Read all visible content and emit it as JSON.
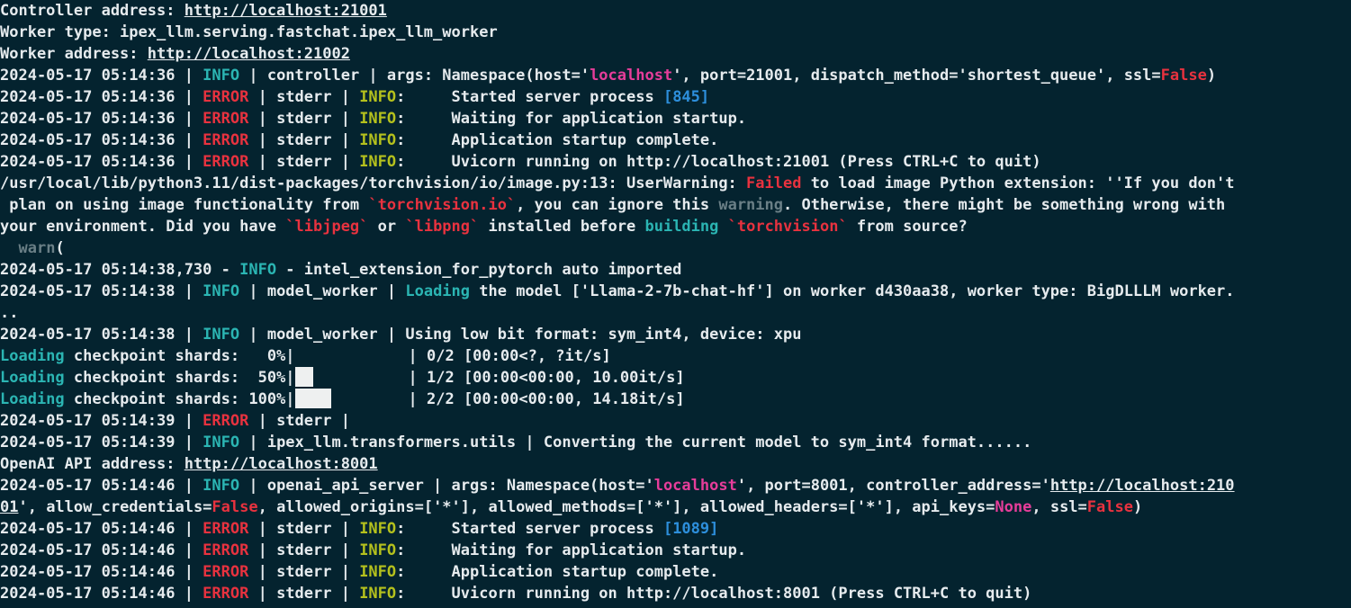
{
  "terminal": {
    "background": "#04232f",
    "lines": [
      [
        {
          "t": "Controller address: ",
          "c": "plain"
        },
        {
          "t": "http://localhost:21001",
          "c": "url"
        }
      ],
      [
        {
          "t": "Worker type: ipex_llm.serving.fastchat.ipex_llm_worker",
          "c": "plain"
        }
      ],
      [
        {
          "t": "Worker address: ",
          "c": "plain"
        },
        {
          "t": "http://localhost:21002",
          "c": "url"
        }
      ],
      [
        {
          "t": "2024-05-17 05:14:36 | ",
          "c": "plain"
        },
        {
          "t": "INFO",
          "c": "info"
        },
        {
          "t": " | controller | args: Namespace(host='",
          "c": "plain"
        },
        {
          "t": "localhost",
          "c": "str"
        },
        {
          "t": "', port=21001, dispatch_method='shortest_queue', ssl=",
          "c": "plain"
        },
        {
          "t": "False",
          "c": "false"
        },
        {
          "t": ")",
          "c": "plain"
        }
      ],
      [
        {
          "t": "2024-05-17 05:14:36 | ",
          "c": "plain"
        },
        {
          "t": "ERROR",
          "c": "error"
        },
        {
          "t": " | stderr | ",
          "c": "plain"
        },
        {
          "t": "INFO",
          "c": "info-y"
        },
        {
          "t": ":     Started server process ",
          "c": "plain"
        },
        {
          "t": "[845]",
          "c": "num"
        }
      ],
      [
        {
          "t": "2024-05-17 05:14:36 | ",
          "c": "plain"
        },
        {
          "t": "ERROR",
          "c": "error"
        },
        {
          "t": " | stderr | ",
          "c": "plain"
        },
        {
          "t": "INFO",
          "c": "info-y"
        },
        {
          "t": ":     Waiting for application startup.",
          "c": "plain"
        }
      ],
      [
        {
          "t": "2024-05-17 05:14:36 | ",
          "c": "plain"
        },
        {
          "t": "ERROR",
          "c": "error"
        },
        {
          "t": " | stderr | ",
          "c": "plain"
        },
        {
          "t": "INFO",
          "c": "info-y"
        },
        {
          "t": ":     Application startup complete.",
          "c": "plain"
        }
      ],
      [
        {
          "t": "2024-05-17 05:14:36 | ",
          "c": "plain"
        },
        {
          "t": "ERROR",
          "c": "error"
        },
        {
          "t": " | stderr | ",
          "c": "plain"
        },
        {
          "t": "INFO",
          "c": "info-y"
        },
        {
          "t": ":     Uvicorn running on http://localhost:21001 (Press CTRL+C to quit)",
          "c": "plain"
        }
      ],
      [
        {
          "t": "/usr/local/lib/python3.11/dist-packages/torchvision/io/image.py:13: UserWarning: ",
          "c": "plain"
        },
        {
          "t": "Failed",
          "c": "red"
        },
        {
          "t": " to load image Python extension: ''If you don't",
          "c": "plain"
        }
      ],
      [
        {
          "t": " plan on using image functionality from ",
          "c": "plain"
        },
        {
          "t": "`torchvision.io`",
          "c": "red"
        },
        {
          "t": ", you can ignore this ",
          "c": "plain"
        },
        {
          "t": "warning",
          "c": "gray"
        },
        {
          "t": ". Otherwise, there might be something wrong with",
          "c": "plain"
        }
      ],
      [
        {
          "t": "your environment. Did you have ",
          "c": "plain"
        },
        {
          "t": "`libjpeg`",
          "c": "red"
        },
        {
          "t": " or ",
          "c": "plain"
        },
        {
          "t": "`libpng`",
          "c": "red"
        },
        {
          "t": " installed before ",
          "c": "plain"
        },
        {
          "t": "building",
          "c": "info"
        },
        {
          "t": " ",
          "c": "plain"
        },
        {
          "t": "`torchvision`",
          "c": "red"
        },
        {
          "t": " from source?",
          "c": "plain"
        }
      ],
      [
        {
          "t": "  ",
          "c": "plain"
        },
        {
          "t": "warn",
          "c": "gray"
        },
        {
          "t": "(",
          "c": "plain"
        }
      ],
      [
        {
          "t": "2024-05-17 05:14:38,730 - ",
          "c": "plain"
        },
        {
          "t": "INFO",
          "c": "info"
        },
        {
          "t": " - intel_extension_for_pytorch auto imported",
          "c": "plain"
        }
      ],
      [
        {
          "t": "2024-05-17 05:14:38 | ",
          "c": "plain"
        },
        {
          "t": "INFO",
          "c": "info"
        },
        {
          "t": " | model_worker | ",
          "c": "plain"
        },
        {
          "t": "Loading",
          "c": "info"
        },
        {
          "t": " the model ['Llama-2-7b-chat-hf'] on worker d430aa38, worker type: BigDLLLM worker.",
          "c": "plain"
        }
      ],
      [
        {
          "t": "..",
          "c": "plain"
        }
      ],
      [
        {
          "t": "2024-05-17 05:14:38 | ",
          "c": "plain"
        },
        {
          "t": "INFO",
          "c": "info"
        },
        {
          "t": " | model_worker | Using low bit format: sym_int4, device: xpu",
          "c": "plain"
        }
      ],
      [
        {
          "t": "Loading",
          "c": "info"
        },
        {
          "t": " checkpoint shards:   0%|",
          "c": "plain"
        },
        {
          "bar": 0
        },
        {
          "t": "| 0/2 [00:00<?, ?it/s]",
          "c": "plain"
        }
      ],
      [
        {
          "t": "Loading",
          "c": "info"
        },
        {
          "t": " checkpoint shards:  50%|",
          "c": "plain"
        },
        {
          "bar": 0.5
        },
        {
          "t": "| 1/2 [00:00<00:00, 10.00it/s]",
          "c": "plain"
        }
      ],
      [
        {
          "t": "Loading",
          "c": "info"
        },
        {
          "t": " checkpoint shards: 100%|",
          "c": "plain"
        },
        {
          "bar": 1
        },
        {
          "t": "| 2/2 [00:00<00:00, 14.18it/s]",
          "c": "plain"
        }
      ],
      [
        {
          "t": "2024-05-17 05:14:39 | ",
          "c": "plain"
        },
        {
          "t": "ERROR",
          "c": "error"
        },
        {
          "t": " | stderr |",
          "c": "plain"
        }
      ],
      [
        {
          "t": "2024-05-17 05:14:39 | ",
          "c": "plain"
        },
        {
          "t": "INFO",
          "c": "info"
        },
        {
          "t": " | ipex_llm.transformers.utils | Converting the current model to sym_int4 format......",
          "c": "plain"
        }
      ],
      [
        {
          "t": "OpenAI API address: ",
          "c": "plain"
        },
        {
          "t": "http://localhost:8001",
          "c": "url"
        }
      ],
      [
        {
          "t": "2024-05-17 05:14:46 | ",
          "c": "plain"
        },
        {
          "t": "INFO",
          "c": "info"
        },
        {
          "t": " | openai_api_server | args: Namespace(host='",
          "c": "plain"
        },
        {
          "t": "localhost",
          "c": "str"
        },
        {
          "t": "', port=8001, controller_address='",
          "c": "plain"
        },
        {
          "t": "http://localhost:210",
          "c": "url"
        }
      ],
      [
        {
          "t": "01",
          "c": "url"
        },
        {
          "t": "', allow_credentials=",
          "c": "plain"
        },
        {
          "t": "False",
          "c": "false"
        },
        {
          "t": ", allowed_origins=['*'], allowed_methods=['*'], allowed_headers=['*'], api_keys=",
          "c": "plain"
        },
        {
          "t": "None",
          "c": "none"
        },
        {
          "t": ", ssl=",
          "c": "plain"
        },
        {
          "t": "False",
          "c": "false"
        },
        {
          "t": ")",
          "c": "plain"
        }
      ],
      [
        {
          "t": "2024-05-17 05:14:46 | ",
          "c": "plain"
        },
        {
          "t": "ERROR",
          "c": "error"
        },
        {
          "t": " | stderr | ",
          "c": "plain"
        },
        {
          "t": "INFO",
          "c": "info-y"
        },
        {
          "t": ":     Started server process ",
          "c": "plain"
        },
        {
          "t": "[1089]",
          "c": "num"
        }
      ],
      [
        {
          "t": "2024-05-17 05:14:46 | ",
          "c": "plain"
        },
        {
          "t": "ERROR",
          "c": "error"
        },
        {
          "t": " | stderr | ",
          "c": "plain"
        },
        {
          "t": "INFO",
          "c": "info-y"
        },
        {
          "t": ":     Waiting for application startup.",
          "c": "plain"
        }
      ],
      [
        {
          "t": "2024-05-17 05:14:46 | ",
          "c": "plain"
        },
        {
          "t": "ERROR",
          "c": "error"
        },
        {
          "t": " | stderr | ",
          "c": "plain"
        },
        {
          "t": "INFO",
          "c": "info-y"
        },
        {
          "t": ":     Application startup complete.",
          "c": "plain"
        }
      ],
      [
        {
          "t": "2024-05-17 05:14:46 | ",
          "c": "plain"
        },
        {
          "t": "ERROR",
          "c": "error"
        },
        {
          "t": " | stderr | ",
          "c": "plain"
        },
        {
          "t": "INFO",
          "c": "info-y"
        },
        {
          "t": ":     Uvicorn running on http://localhost:8001 (Press CTRL+C to quit)",
          "c": "plain"
        }
      ]
    ]
  }
}
